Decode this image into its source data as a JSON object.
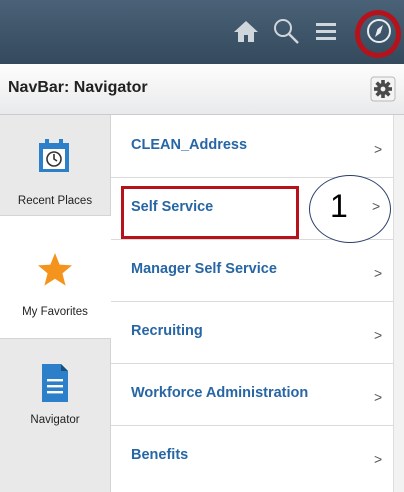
{
  "header": {
    "icons": [
      "home-icon",
      "search-icon",
      "actions-menu-icon",
      "navbar-compass-icon"
    ]
  },
  "titlebar": {
    "title": "NavBar: Navigator",
    "gear_icon": "gear-icon"
  },
  "left_panel": {
    "items": [
      {
        "label": "Recent Places",
        "icon": "calendar-clock-icon",
        "active": false
      },
      {
        "label": "My Favorites",
        "icon": "star-icon",
        "active": false
      },
      {
        "label": "Navigator",
        "icon": "document-list-icon",
        "active": true
      }
    ]
  },
  "navigator_list": {
    "items": [
      {
        "label": "CLEAN_Address"
      },
      {
        "label": "Self Service",
        "highlighted": true
      },
      {
        "label": "Manager Self Service"
      },
      {
        "label": "Recruiting"
      },
      {
        "label": "Workforce Administration"
      },
      {
        "label": "Benefits"
      }
    ],
    "chevron": ">"
  },
  "annotation": {
    "callout_number": "1",
    "highlight_color": "#b5121b",
    "callout_border_color": "#2a3e6c"
  },
  "colors": {
    "header_bg": "#3d5468",
    "link_blue": "#2766a5",
    "star_orange": "#f4941d",
    "icon_blue": "#2c7fc9"
  }
}
